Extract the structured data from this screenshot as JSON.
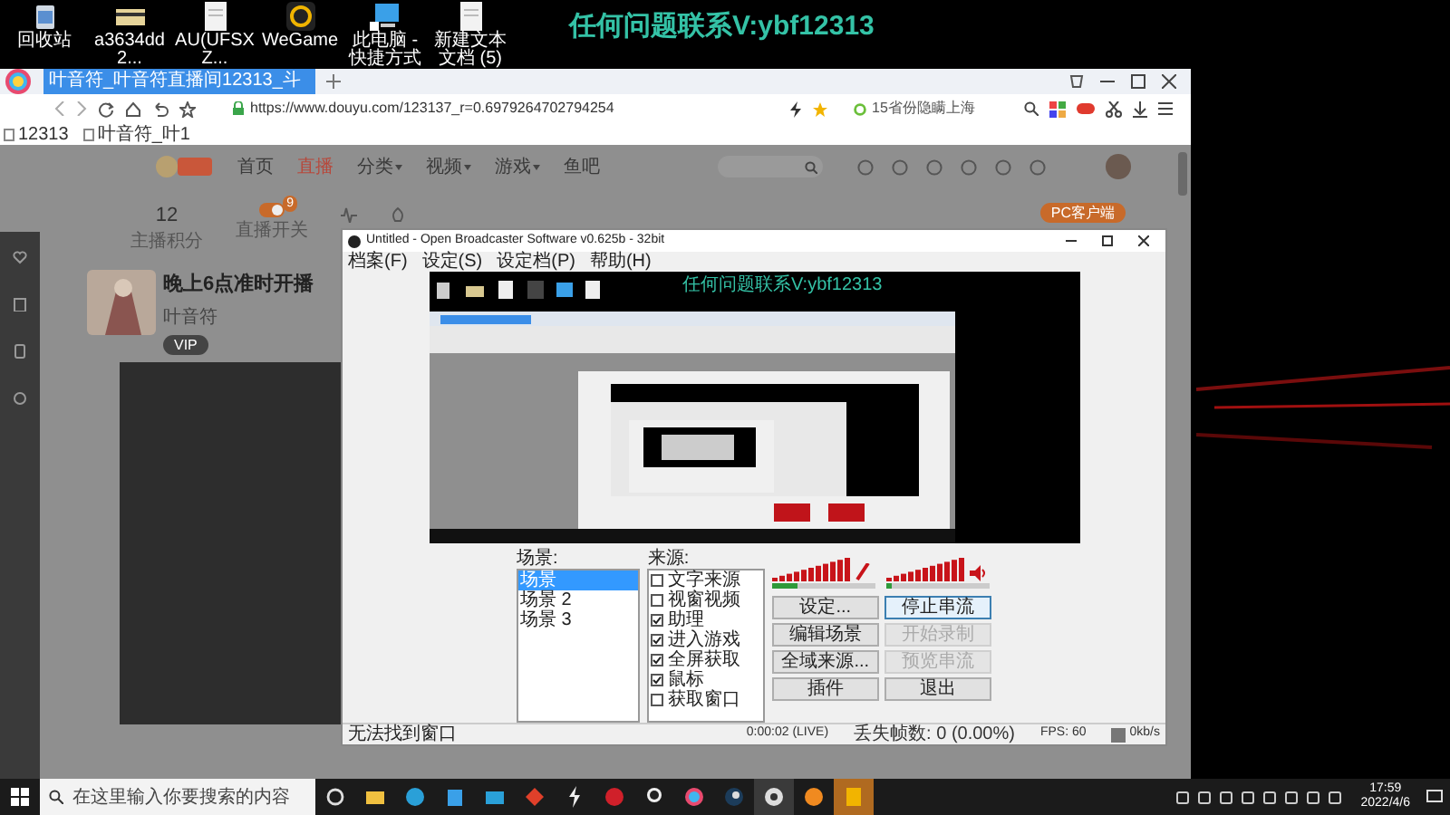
{
  "desktop": {
    "watermark": "任何问题联系V:ybf12313",
    "icons": [
      {
        "label": "回收站",
        "kind": "bin"
      },
      {
        "label": "a3634dd2...",
        "kind": "card"
      },
      {
        "label": "AU(UFSXZ...",
        "kind": "doc"
      },
      {
        "label": "WeGame",
        "kind": "app"
      },
      {
        "label": "此电脑 - 快捷方式",
        "kind": "pc"
      },
      {
        "label": "新建文本文档 (5)",
        "kind": "doc"
      }
    ]
  },
  "browser": {
    "tab": {
      "title": "叶音符_叶音符直播间12313_斗",
      "selected": true
    },
    "url": "https://www.douyu.com/123137_r=0.6979264702794254",
    "search": {
      "placeholder": "15省份隐瞒上海"
    },
    "bookmarks": [
      "12313",
      "叶音符_叶1"
    ],
    "nav": [
      {
        "label": "首页",
        "selected": false,
        "has_menu": false
      },
      {
        "label": "直播",
        "selected": true,
        "has_menu": false
      },
      {
        "label": "分类",
        "selected": false,
        "has_menu": true
      },
      {
        "label": "视频",
        "selected": false,
        "has_menu": true
      },
      {
        "label": "游戏",
        "selected": false,
        "has_menu": true
      },
      {
        "label": "鱼吧",
        "selected": false,
        "has_menu": false
      }
    ],
    "stats": [
      {
        "value": "12",
        "label": "主播积分"
      },
      {
        "label": "直播开关",
        "badge": "9"
      }
    ],
    "pc_button": "PC客户端",
    "card": {
      "title": "晚上6点准时开播",
      "streamer": "叶音符",
      "tag": "VIP"
    }
  },
  "obs": {
    "title": "Untitled - Open Broadcaster Software v0.625b - 32bit",
    "menu": [
      "档案(F)",
      "设定(S)",
      "设定档(P)",
      "帮助(H)"
    ],
    "preview_text": "任何问题联系V:ybf12313",
    "scenes_label": "场景:",
    "scenes": [
      {
        "label": "场景",
        "selected": true
      },
      {
        "label": "场景 2",
        "selected": false
      },
      {
        "label": "场景 3",
        "selected": false
      }
    ],
    "sources_label": "来源:",
    "sources": [
      {
        "label": "文字来源",
        "checked": false
      },
      {
        "label": "视窗视频",
        "checked": false
      },
      {
        "label": "助理",
        "checked": true
      },
      {
        "label": "进入游戏",
        "checked": true
      },
      {
        "label": "全屏获取",
        "checked": true
      },
      {
        "label": "鼠标",
        "checked": true
      },
      {
        "label": "获取窗口",
        "checked": false
      }
    ],
    "meters": [
      {
        "kind": "mic",
        "level": 0.25
      },
      {
        "kind": "speaker",
        "level": 0.05
      }
    ],
    "buttons": [
      {
        "label": "设定...",
        "disabled": false,
        "selected": false
      },
      {
        "label": "停止串流",
        "disabled": false,
        "selected": true
      },
      {
        "label": "编辑场景",
        "disabled": false,
        "selected": false
      },
      {
        "label": "开始录制",
        "disabled": true,
        "selected": false
      },
      {
        "label": "全域来源...",
        "disabled": false,
        "selected": false
      },
      {
        "label": "预览串流",
        "disabled": true,
        "selected": false
      },
      {
        "label": "插件",
        "disabled": false,
        "selected": false
      },
      {
        "label": "退出",
        "disabled": false,
        "selected": false
      }
    ],
    "status": {
      "message": "无法找到窗口",
      "time": "0:00:02 (LIVE)",
      "dropped": "丢失帧数: 0 (0.00%)",
      "fps": "FPS: 60",
      "rate": "0kb/s"
    }
  },
  "taskbar": {
    "search": {
      "placeholder": "在这里输入你要搜索的内容"
    },
    "time": "17:59",
    "date": "2022/4/6"
  }
}
